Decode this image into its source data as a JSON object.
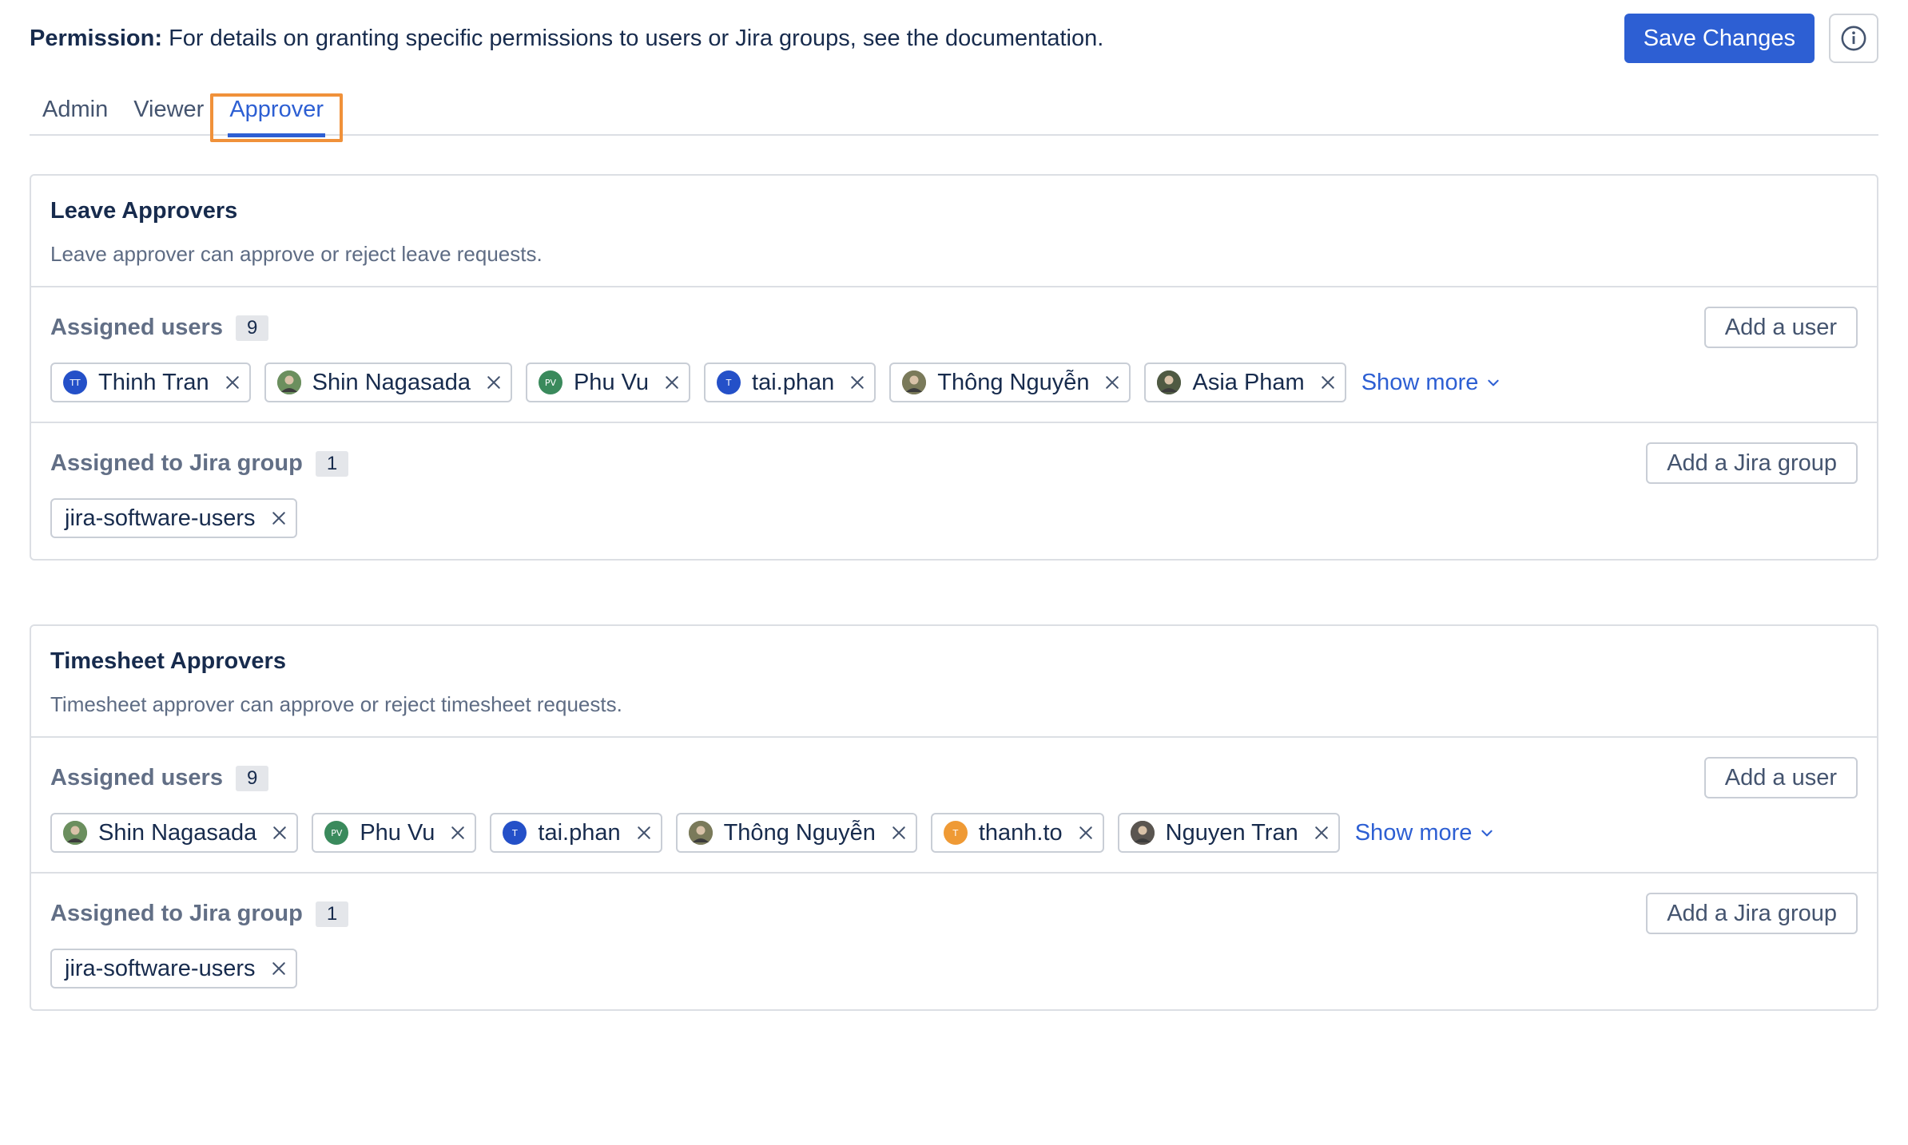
{
  "header": {
    "permission_label": "Permission:",
    "permission_text": "For details on granting specific permissions to users or Jira groups, see the documentation.",
    "save_label": "Save Changes",
    "info_icon": "info-icon"
  },
  "tabs": [
    {
      "label": "Admin",
      "active": false
    },
    {
      "label": "Viewer",
      "active": false
    },
    {
      "label": "Approver",
      "active": true
    }
  ],
  "colors": {
    "primary": "#2d5fd3",
    "highlight": "#f0913a",
    "border": "#dcdfe4"
  },
  "leave": {
    "title": "Leave Approvers",
    "description": "Leave approver can approve or reject leave requests.",
    "users_label": "Assigned users",
    "users_count": "9",
    "add_user_label": "Add a user",
    "users": [
      {
        "name": "Thinh Tran",
        "initials": "TT",
        "color": "#2450c8",
        "photo": false
      },
      {
        "name": "Shin Nagasada",
        "initials": "",
        "color": "#6b8f5e",
        "photo": true
      },
      {
        "name": "Phu Vu",
        "initials": "PV",
        "color": "#3a8a5c",
        "photo": false
      },
      {
        "name": "tai.phan",
        "initials": "T",
        "color": "#2450c8",
        "photo": false
      },
      {
        "name": "Thông Nguyễn",
        "initials": "",
        "color": "#7a7a5a",
        "photo": true
      },
      {
        "name": "Asia Pham",
        "initials": "",
        "color": "#4f5a43",
        "photo": true
      }
    ],
    "show_more_label": "Show more",
    "groups_label": "Assigned to Jira group",
    "groups_count": "1",
    "add_group_label": "Add a Jira group",
    "groups": [
      "jira-software-users"
    ]
  },
  "timesheet": {
    "title": "Timesheet Approvers",
    "description": "Timesheet approver can approve or reject timesheet requests.",
    "users_label": "Assigned users",
    "users_count": "9",
    "add_user_label": "Add a user",
    "users": [
      {
        "name": "Shin Nagasada",
        "initials": "",
        "color": "#6b8f5e",
        "photo": true
      },
      {
        "name": "Phu Vu",
        "initials": "PV",
        "color": "#3a8a5c",
        "photo": false
      },
      {
        "name": "tai.phan",
        "initials": "T",
        "color": "#2450c8",
        "photo": false
      },
      {
        "name": "Thông Nguyễn",
        "initials": "",
        "color": "#7a7a5a",
        "photo": true
      },
      {
        "name": "thanh.to",
        "initials": "T",
        "color": "#ef9a35",
        "photo": false
      },
      {
        "name": "Nguyen Tran",
        "initials": "",
        "color": "#5a5550",
        "photo": true
      }
    ],
    "show_more_label": "Show more",
    "groups_label": "Assigned to Jira group",
    "groups_count": "1",
    "add_group_label": "Add a Jira group",
    "groups": [
      "jira-software-users"
    ]
  }
}
